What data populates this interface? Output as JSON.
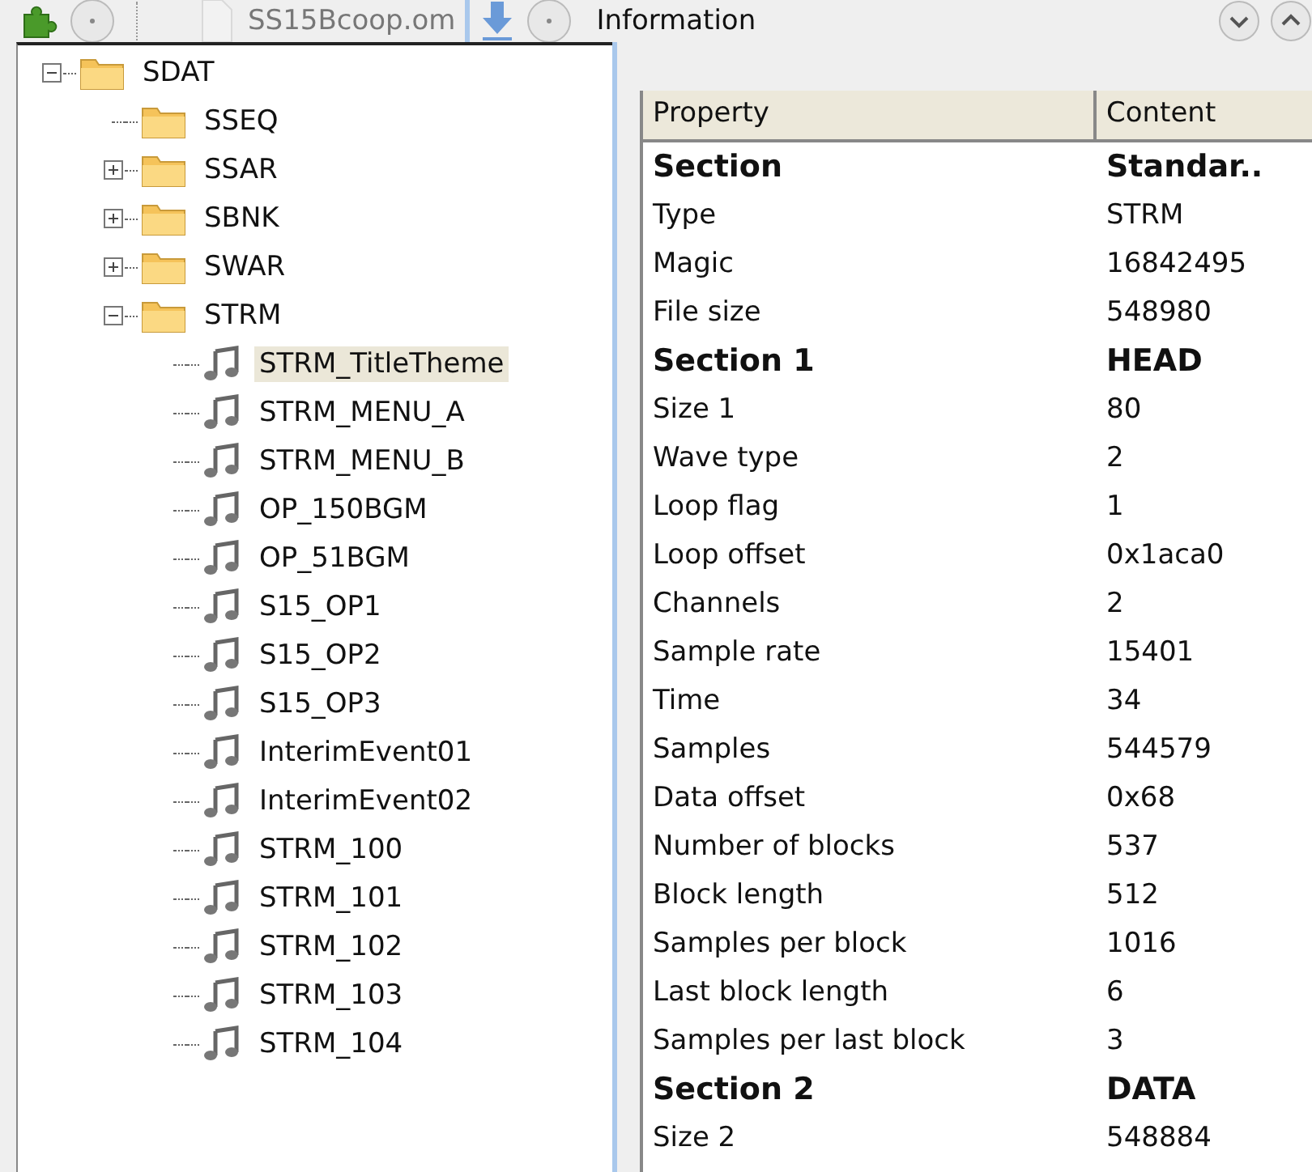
{
  "toolbar": {
    "file_name": "SS15Bcoop.om",
    "panel_title": "Information"
  },
  "tree": [
    {
      "label": "SDAT",
      "kind": "folder",
      "expanded": true,
      "selected": false,
      "children": [
        {
          "label": "SSEQ",
          "kind": "folder",
          "selected": false
        },
        {
          "label": "SSAR",
          "kind": "folder",
          "expanded": false,
          "selected": false
        },
        {
          "label": "SBNK",
          "kind": "folder",
          "expanded": false,
          "selected": false
        },
        {
          "label": "SWAR",
          "kind": "folder",
          "expanded": false,
          "selected": false
        },
        {
          "label": "STRM",
          "kind": "folder",
          "expanded": true,
          "selected": false,
          "children": [
            {
              "label": "STRM_TitleTheme",
              "kind": "sound",
              "selected": true
            },
            {
              "label": "STRM_MENU_A",
              "kind": "sound",
              "selected": false
            },
            {
              "label": "STRM_MENU_B",
              "kind": "sound",
              "selected": false
            },
            {
              "label": "OP_150BGM",
              "kind": "sound",
              "selected": false
            },
            {
              "label": "OP_51BGM",
              "kind": "sound",
              "selected": false
            },
            {
              "label": "S15_OP1",
              "kind": "sound",
              "selected": false
            },
            {
              "label": "S15_OP2",
              "kind": "sound",
              "selected": false
            },
            {
              "label": "S15_OP3",
              "kind": "sound",
              "selected": false
            },
            {
              "label": "InterimEvent01",
              "kind": "sound",
              "selected": false
            },
            {
              "label": "InterimEvent02",
              "kind": "sound",
              "selected": false
            },
            {
              "label": "STRM_100",
              "kind": "sound",
              "selected": false
            },
            {
              "label": "STRM_101",
              "kind": "sound",
              "selected": false
            },
            {
              "label": "STRM_102",
              "kind": "sound",
              "selected": false
            },
            {
              "label": "STRM_103",
              "kind": "sound",
              "selected": false
            },
            {
              "label": "STRM_104",
              "kind": "sound",
              "selected": false
            }
          ]
        }
      ]
    }
  ],
  "table": {
    "columns": [
      "Property",
      "Content"
    ],
    "rows": [
      {
        "kind": "section",
        "property": "Section",
        "content": "Standar.."
      },
      {
        "kind": "field",
        "property": "Type",
        "content": "STRM"
      },
      {
        "kind": "field",
        "property": "Magic",
        "content": "16842495"
      },
      {
        "kind": "field",
        "property": "File size",
        "content": "548980"
      },
      {
        "kind": "section",
        "property": "Section 1",
        "content": "HEAD"
      },
      {
        "kind": "field",
        "property": "Size 1",
        "content": "80"
      },
      {
        "kind": "field",
        "property": "Wave type",
        "content": "2"
      },
      {
        "kind": "field",
        "property": "Loop flag",
        "content": "1"
      },
      {
        "kind": "field",
        "property": "Loop offset",
        "content": "0x1aca0"
      },
      {
        "kind": "field",
        "property": "Channels",
        "content": "2"
      },
      {
        "kind": "field",
        "property": "Sample rate",
        "content": "15401"
      },
      {
        "kind": "field",
        "property": "Time",
        "content": "34"
      },
      {
        "kind": "field",
        "property": "Samples",
        "content": "544579"
      },
      {
        "kind": "field",
        "property": "Data offset",
        "content": "0x68"
      },
      {
        "kind": "field",
        "property": "Number of blocks",
        "content": "537"
      },
      {
        "kind": "field",
        "property": "Block length",
        "content": "512"
      },
      {
        "kind": "field",
        "property": "Samples per block",
        "content": "1016"
      },
      {
        "kind": "field",
        "property": "Last block length",
        "content": "6"
      },
      {
        "kind": "field",
        "property": "Samples per last block",
        "content": "3"
      },
      {
        "kind": "section",
        "property": "Section 2",
        "content": "DATA"
      },
      {
        "kind": "field",
        "property": "Size 2",
        "content": "548884"
      }
    ]
  }
}
